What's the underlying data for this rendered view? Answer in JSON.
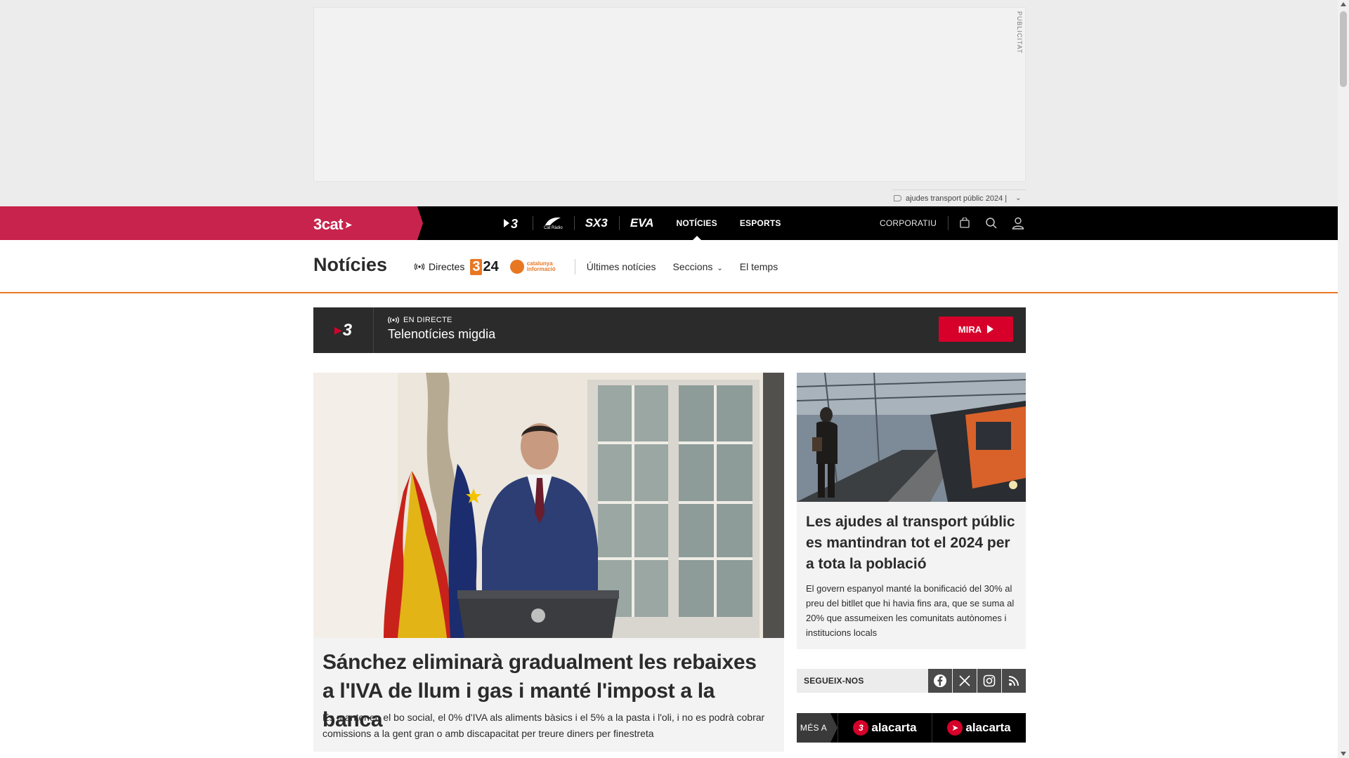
{
  "ad": {
    "label": "PUBLICITAT",
    "tag": "ajudes transport públic 2024 |"
  },
  "topnav": {
    "brand": "3cat",
    "channels": [
      {
        "name": "3",
        "icon": "tv3-logo"
      },
      {
        "name": "",
        "sub": "Cat Ràdio",
        "icon": "catradio-logo"
      },
      {
        "name": "SX3",
        "icon": "sx3-logo"
      },
      {
        "name": "EVA",
        "icon": "eva-logo"
      }
    ],
    "links": [
      "NOTÍCIES",
      "ESPORTS"
    ],
    "corporatiu": "CORPORATIU"
  },
  "section": {
    "title": "Notícies",
    "directes": "Directes",
    "logo_324": "324",
    "logo_ci": "catalunya informació",
    "links": [
      "Últimes notícies",
      "Seccions",
      "El temps"
    ]
  },
  "live": {
    "channel_logo": "3",
    "tag": "EN DIRECTE",
    "title": "Telenotícies migdia",
    "button": "MIRA"
  },
  "main_article": {
    "headline": "Sánchez eliminarà gradualment les rebaixes a l'IVA de llum i gas i manté l'impost a la banca",
    "summary": "Es mantenen el bo social, el 0% d'IVA als aliments bàsics i el 5% a la pasta i l'oli, i no es podrà cobrar comissions a la gent gran o amb discapacitat per treure diners per finestreta"
  },
  "side_article": {
    "headline": "Les ajudes al transport públic es mantindran tot el 2024 per a tota la població",
    "summary": "El govern espanyol manté la bonificació del 30% al preu del bitllet que hi havia fins ara, que se suma al 20% que assumeixen les comunitats autònomes i institucions locals"
  },
  "follow": {
    "label": "SEGUEIX-NOS",
    "networks": [
      "facebook-icon",
      "x-icon",
      "instagram-icon",
      "rss-icon"
    ]
  },
  "mesa": {
    "label": "MÉS A",
    "items": [
      "alacarta",
      "alacarta"
    ]
  },
  "colors": {
    "brand": "#c8234c",
    "accent_orange": "#e87722",
    "live_red": "#d6002a"
  }
}
